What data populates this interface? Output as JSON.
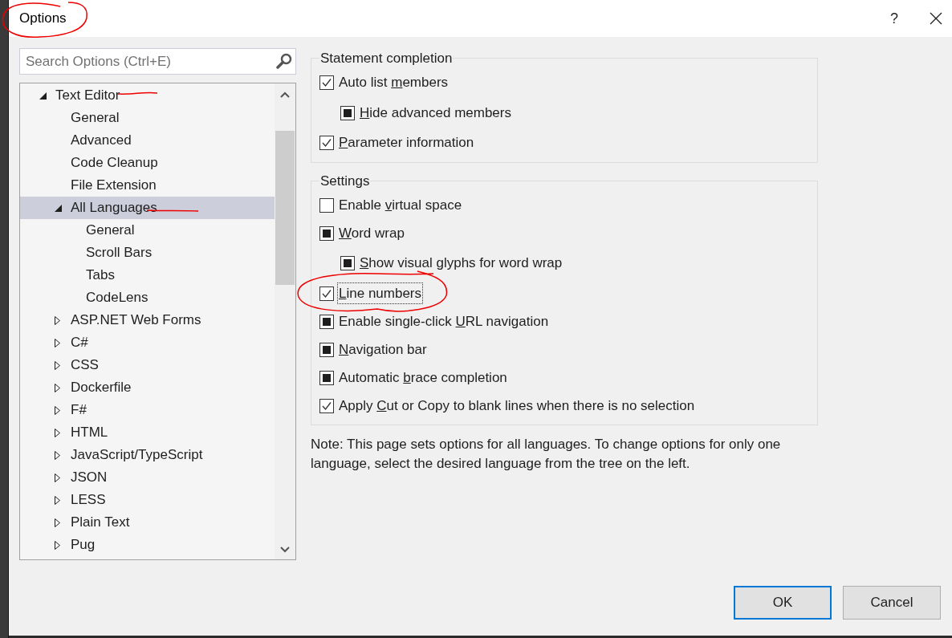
{
  "window": {
    "title": "Options",
    "help_glyph": "?"
  },
  "search": {
    "placeholder": "Search Options (Ctrl+E)"
  },
  "tree": [
    {
      "label": "Text Editor",
      "expanded": true,
      "selected": false,
      "children": [
        {
          "label": "General",
          "selected": false
        },
        {
          "label": "Advanced",
          "selected": false
        },
        {
          "label": "Code Cleanup",
          "selected": false
        },
        {
          "label": "File Extension",
          "selected": false
        },
        {
          "label": "All Languages",
          "expanded": true,
          "selected": true,
          "children": [
            {
              "label": "General",
              "selected": false
            },
            {
              "label": "Scroll Bars",
              "selected": false
            },
            {
              "label": "Tabs",
              "selected": false
            },
            {
              "label": "CodeLens",
              "selected": false
            }
          ]
        },
        {
          "label": "ASP.NET Web Forms",
          "expanded": false,
          "selected": false
        },
        {
          "label": "C#",
          "expanded": false,
          "selected": false
        },
        {
          "label": "CSS",
          "expanded": false,
          "selected": false
        },
        {
          "label": "Dockerfile",
          "expanded": false,
          "selected": false
        },
        {
          "label": "F#",
          "expanded": false,
          "selected": false
        },
        {
          "label": "HTML",
          "expanded": false,
          "selected": false
        },
        {
          "label": "JavaScript/TypeScript",
          "expanded": false,
          "selected": false
        },
        {
          "label": "JSON",
          "expanded": false,
          "selected": false
        },
        {
          "label": "LESS",
          "expanded": false,
          "selected": false
        },
        {
          "label": "Plain Text",
          "expanded": false,
          "selected": false
        },
        {
          "label": "Pug",
          "expanded": false,
          "selected": false
        }
      ]
    }
  ],
  "groups": [
    {
      "title": "Statement completion",
      "options": [
        {
          "text_before": "Auto list ",
          "access_key": "m",
          "text_after": "embers",
          "checked": true,
          "indeterminate": false,
          "focused": false,
          "children": [
            {
              "access_key": "H",
              "text_after": "ide advanced members",
              "checked": false,
              "indeterminate": true,
              "focused": false
            }
          ]
        },
        {
          "access_key": "P",
          "text_after": "arameter information",
          "checked": true,
          "indeterminate": false,
          "focused": false
        }
      ]
    },
    {
      "title": "Settings",
      "options": [
        {
          "text_before": "Enable ",
          "access_key": "v",
          "text_after": "irtual space",
          "checked": false,
          "indeterminate": false,
          "focused": false
        },
        {
          "access_key": "W",
          "text_after": "ord wrap",
          "checked": false,
          "indeterminate": true,
          "focused": false,
          "children": [
            {
              "access_key": "S",
              "text_after": "how visual glyphs for word wrap",
              "checked": false,
              "indeterminate": true,
              "focused": false
            }
          ]
        },
        {
          "access_key": "L",
          "text_after": "ine numbers",
          "checked": true,
          "indeterminate": false,
          "focused": true
        },
        {
          "text_before": "Enable single-click ",
          "access_key": "U",
          "text_after": "RL navigation",
          "checked": false,
          "indeterminate": true,
          "focused": false
        },
        {
          "access_key": "N",
          "text_after": "avigation bar",
          "checked": false,
          "indeterminate": true,
          "focused": false
        },
        {
          "text_before": "Automatic ",
          "access_key": "b",
          "text_after": "race completion",
          "checked": false,
          "indeterminate": true,
          "focused": false
        },
        {
          "text_before": "Apply ",
          "access_key": "C",
          "text_after": "ut or Copy to blank lines when there is no selection",
          "checked": true,
          "indeterminate": false,
          "focused": false
        }
      ]
    }
  ],
  "note": "Note: This page sets options for all languages. To change options for only one language, select the desired language from the tree on the left.",
  "buttons": [
    {
      "label": "OK",
      "default": true
    },
    {
      "label": "Cancel",
      "default": false
    }
  ]
}
